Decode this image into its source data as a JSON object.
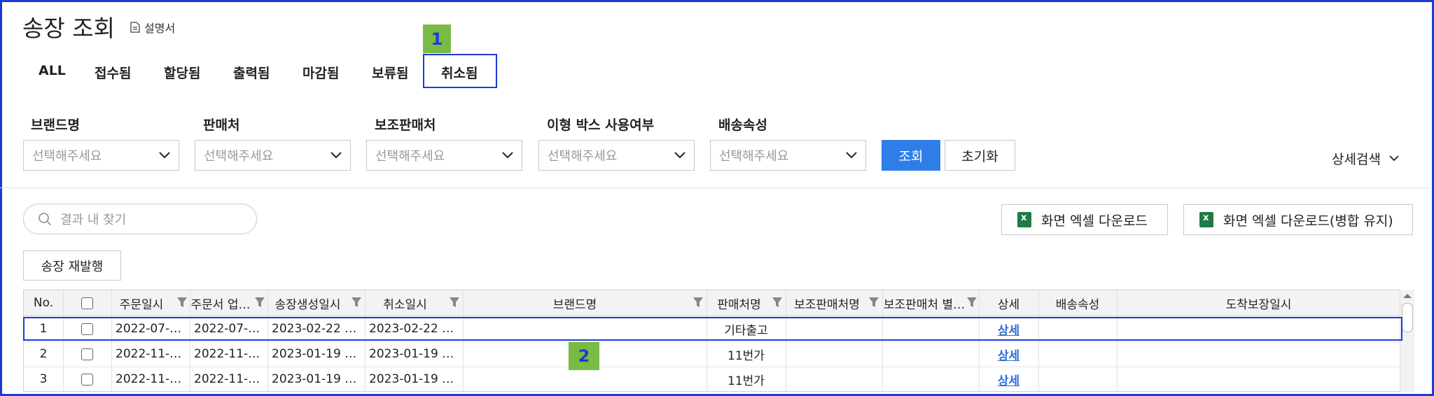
{
  "page": {
    "title": "송장 조회",
    "manual_label": "설명서"
  },
  "tabs": [
    {
      "label": "ALL"
    },
    {
      "label": "접수됨"
    },
    {
      "label": "할당됨"
    },
    {
      "label": "출력됨"
    },
    {
      "label": "마감됨"
    },
    {
      "label": "보류됨"
    },
    {
      "label": "취소됨",
      "selected": true
    }
  ],
  "annotations": {
    "tab_marker": "1",
    "row_marker": "2",
    "marker_color": "#79bb45",
    "highlight_color": "#1e3ad6"
  },
  "filters": [
    {
      "label": "브랜드명",
      "placeholder": "선택해주세요"
    },
    {
      "label": "판매처",
      "placeholder": "선택해주세요"
    },
    {
      "label": "보조판매처",
      "placeholder": "선택해주세요"
    },
    {
      "label": "이형 박스 사용여부",
      "placeholder": "선택해주세요"
    },
    {
      "label": "배송속성",
      "placeholder": "선택해주세요"
    }
  ],
  "actions": {
    "search": "조회",
    "reset": "초기화",
    "advanced_search": "상세검색",
    "result_search_placeholder": "결과 내 찾기",
    "excel_download": "화면 엑셀 다운로드",
    "excel_download_merged": "화면 엑셀 다운로드(병합 유지)",
    "reissue": "송장 재발행"
  },
  "colors": {
    "primary_button": "#2f7ee8",
    "link": "#2f6fd8",
    "excel_icon": "#1f7a45"
  },
  "table": {
    "headers": {
      "no": "No.",
      "order_date": "주문일시",
      "order_upload": "주문서 업…",
      "invoice_created": "송장생성일시",
      "cancel_date": "취소일시",
      "brand": "브랜드명",
      "seller": "판매처명",
      "sub_seller": "보조판매처명",
      "sub_seller_alias": "보조판매처 별…",
      "detail": "상세",
      "shipping_attr": "배송속성",
      "arrival_guarantee": "도착보장일시"
    },
    "rows": [
      {
        "no": "1",
        "order_date": "2022-07-…",
        "order_upload": "2022-07-…",
        "invoice_created": "2023-02-22 …",
        "cancel_date": "2023-02-22 …",
        "brand": "",
        "seller": "기타출고",
        "sub_seller": "",
        "sub_seller_alias": "",
        "detail": "상세",
        "shipping_attr": "",
        "arrival_guarantee": ""
      },
      {
        "no": "2",
        "order_date": "2022-11-…",
        "order_upload": "2022-11-…",
        "invoice_created": "2023-01-19 …",
        "cancel_date": "2023-01-19 …",
        "brand": "",
        "seller": "11번가",
        "sub_seller": "",
        "sub_seller_alias": "",
        "detail": "상세",
        "shipping_attr": "",
        "arrival_guarantee": ""
      },
      {
        "no": "3",
        "order_date": "2022-11-…",
        "order_upload": "2022-11-…",
        "invoice_created": "2023-01-19 …",
        "cancel_date": "2023-01-19 …",
        "brand": "",
        "seller": "11번가",
        "sub_seller": "",
        "sub_seller_alias": "",
        "detail": "상세",
        "shipping_attr": "",
        "arrival_guarantee": ""
      }
    ]
  }
}
